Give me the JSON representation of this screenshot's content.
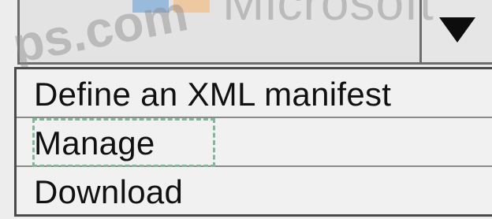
{
  "watermark": {
    "brand_text": "Microsoft",
    "site_text": "ps.com",
    "logo_colors": [
      "#5b9bd5",
      "#f6b26b"
    ]
  },
  "combo": {
    "selected_value": "",
    "arrow_icon": "triangle-down-icon"
  },
  "dropdown": {
    "options": [
      {
        "label": "Define an XML manifest"
      },
      {
        "label": "Manage"
      },
      {
        "label": "Download"
      }
    ],
    "focused_index": 1,
    "focus_color": "#7fb99a"
  }
}
